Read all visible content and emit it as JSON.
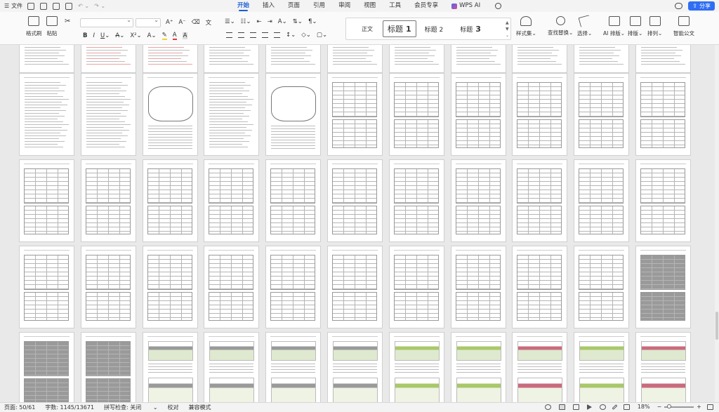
{
  "menubar": {
    "file_label": "文件",
    "tabs": [
      "开始",
      "插入",
      "页面",
      "引用",
      "审阅",
      "视图",
      "工具",
      "会员专享"
    ],
    "active_tab": "开始",
    "wps_ai_label": "WPS AI",
    "share_label": "分享"
  },
  "ribbon": {
    "format_painter": "格式刷",
    "paste": "粘贴",
    "styles": {
      "normal": "正文",
      "h1_prefix": "标题",
      "h1_num": "1",
      "h2": "标题 2",
      "h3_prefix": "标题",
      "h3_num": "3"
    },
    "style_set": "样式集",
    "find_replace": "查找替换",
    "select": "选择",
    "ai_layout": "AI 排版",
    "layout": "排版",
    "arrange": "排列",
    "smart_doc": "智能公文"
  },
  "colors": {
    "accent": "#1a5fd6",
    "share_bg": "#2f6ef4",
    "doc_bg": "#e9e9e9"
  },
  "statusbar": {
    "page": "页面: 50/61",
    "word_count": "字数: 1145/13671",
    "spell_check": "拼写检查: 关闭",
    "proofread": "校对",
    "compat_mode": "兼容模式",
    "zoom": "18%"
  }
}
